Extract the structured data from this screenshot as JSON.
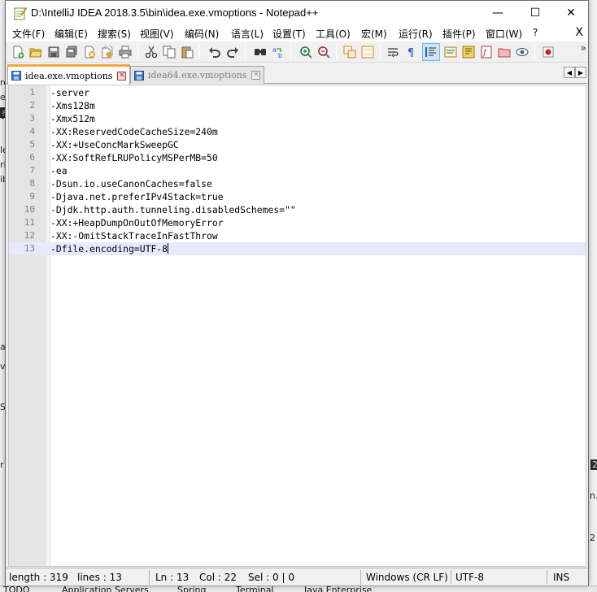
{
  "window": {
    "title": "D:\\IntelliJ IDEA 2018.3.5\\bin\\idea.exe.vmoptions - Notepad++",
    "minimize": "—",
    "maximize": "☐",
    "close": "✕"
  },
  "menu": {
    "items": [
      "文件(F)",
      "编辑(E)",
      "搜索(S)",
      "视图(V)",
      "编码(N)",
      "语言(L)",
      "设置(T)",
      "工具(O)",
      "宏(M)",
      "运行(R)",
      "插件(P)",
      "窗口(W)",
      "?"
    ],
    "close_doc": "X"
  },
  "toolbar": {
    "icons": [
      "new-file-icon",
      "open-file-icon",
      "save-icon",
      "save-all-icon",
      "close-icon",
      "close-all-icon",
      "print-icon",
      "cut-icon",
      "copy-icon",
      "paste-icon",
      "undo-icon",
      "redo-icon",
      "find-icon",
      "replace-icon",
      "zoom-in-icon",
      "zoom-out-icon",
      "sync-vertical-icon",
      "sync-horizontal-icon",
      "word-wrap-icon",
      "show-all-chars-icon",
      "indent-guide-icon",
      "user-lang-icon",
      "doc-map-icon",
      "function-list-icon",
      "folder-workspace-icon",
      "monitor-icon",
      "record-macro-icon"
    ],
    "more": "»"
  },
  "tabs": [
    {
      "label": "idea.exe.vmoptions",
      "active": true
    },
    {
      "label": "idea64.exe.vmoptions",
      "active": false
    }
  ],
  "tab_scroll": {
    "left": "◀",
    "right": "▶"
  },
  "editor": {
    "lines": [
      "-server",
      "-Xms128m",
      "-Xmx512m",
      "-XX:ReservedCodeCacheSize=240m",
      "-XX:+UseConcMarkSweepGC",
      "-XX:SoftRefLRUPolicyMSPerMB=50",
      "-ea",
      "-Dsun.io.useCanonCaches=false",
      "-Djava.net.preferIPv4Stack=true",
      "-Djdk.http.auth.tunneling.disabledSchemes=\"\"",
      "-XX:+HeapDumpOnOutOfMemoryError",
      "-XX:-OmitStackTraceInFastThrow",
      "-Dfile.encoding=UTF-8"
    ],
    "line_numbers": [
      "1",
      "2",
      "3",
      "4",
      "5",
      "6",
      "7",
      "8",
      "9",
      "10",
      "11",
      "12",
      "13"
    ],
    "current_line": 13
  },
  "status": {
    "length": "length : 319",
    "lines": "lines : 13",
    "ln": "Ln : 13",
    "col": "Col : 22",
    "sel": "Sel : 0 | 0",
    "eol": "Windows (CR LF)",
    "encoding": "UTF-8",
    "mode": "INS"
  },
  "background": {
    "left_fragments": [
      "ro",
      "er",
      "ai",
      "ou",
      "le",
      "ri",
      "ib",
      "a",
      "ve",
      "St",
      "r"
    ],
    "right_fragments": [
      "2",
      "n.",
      "2"
    ],
    "bottom_items": [
      "TODO",
      "Application Servers",
      "Spring",
      "Terminal",
      "Java Enterprise"
    ]
  }
}
